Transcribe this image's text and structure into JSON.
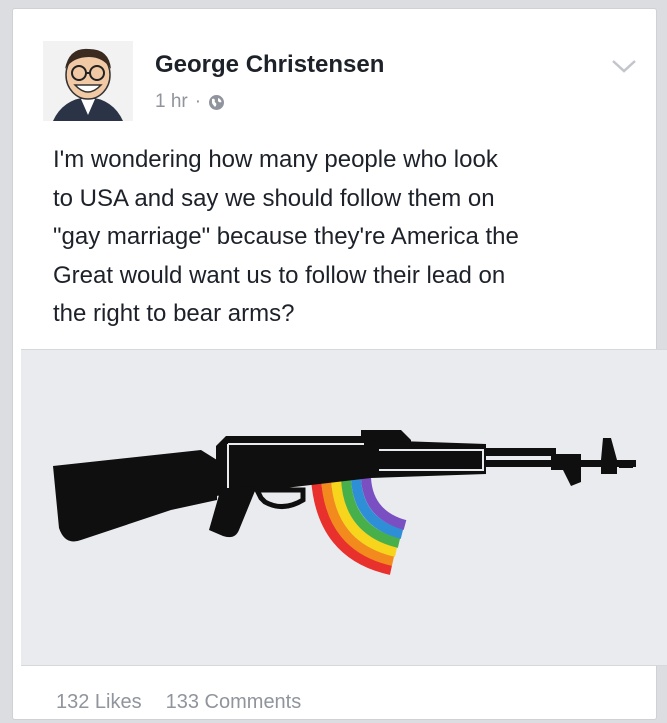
{
  "post": {
    "author": "George Christensen",
    "time": "1 hr",
    "separator": "·",
    "lines": [
      "I'm wondering how many people who look",
      "to USA and say we should follow them on",
      "\"gay marriage\" because they're America the",
      "Great would want us to follow their lead on",
      "the right to bear arms?"
    ],
    "likes": "132 Likes",
    "comments": "133 Comments"
  },
  "icons": {
    "privacy": "globe-icon",
    "menu": "chevron-down-icon"
  },
  "colors": {
    "name": "#1d2129",
    "meta": "#90949c",
    "rainbow": [
      "#e8302d",
      "#f28a1e",
      "#f7d51d",
      "#47b04a",
      "#2f8fd6",
      "#7a4fc2"
    ]
  }
}
